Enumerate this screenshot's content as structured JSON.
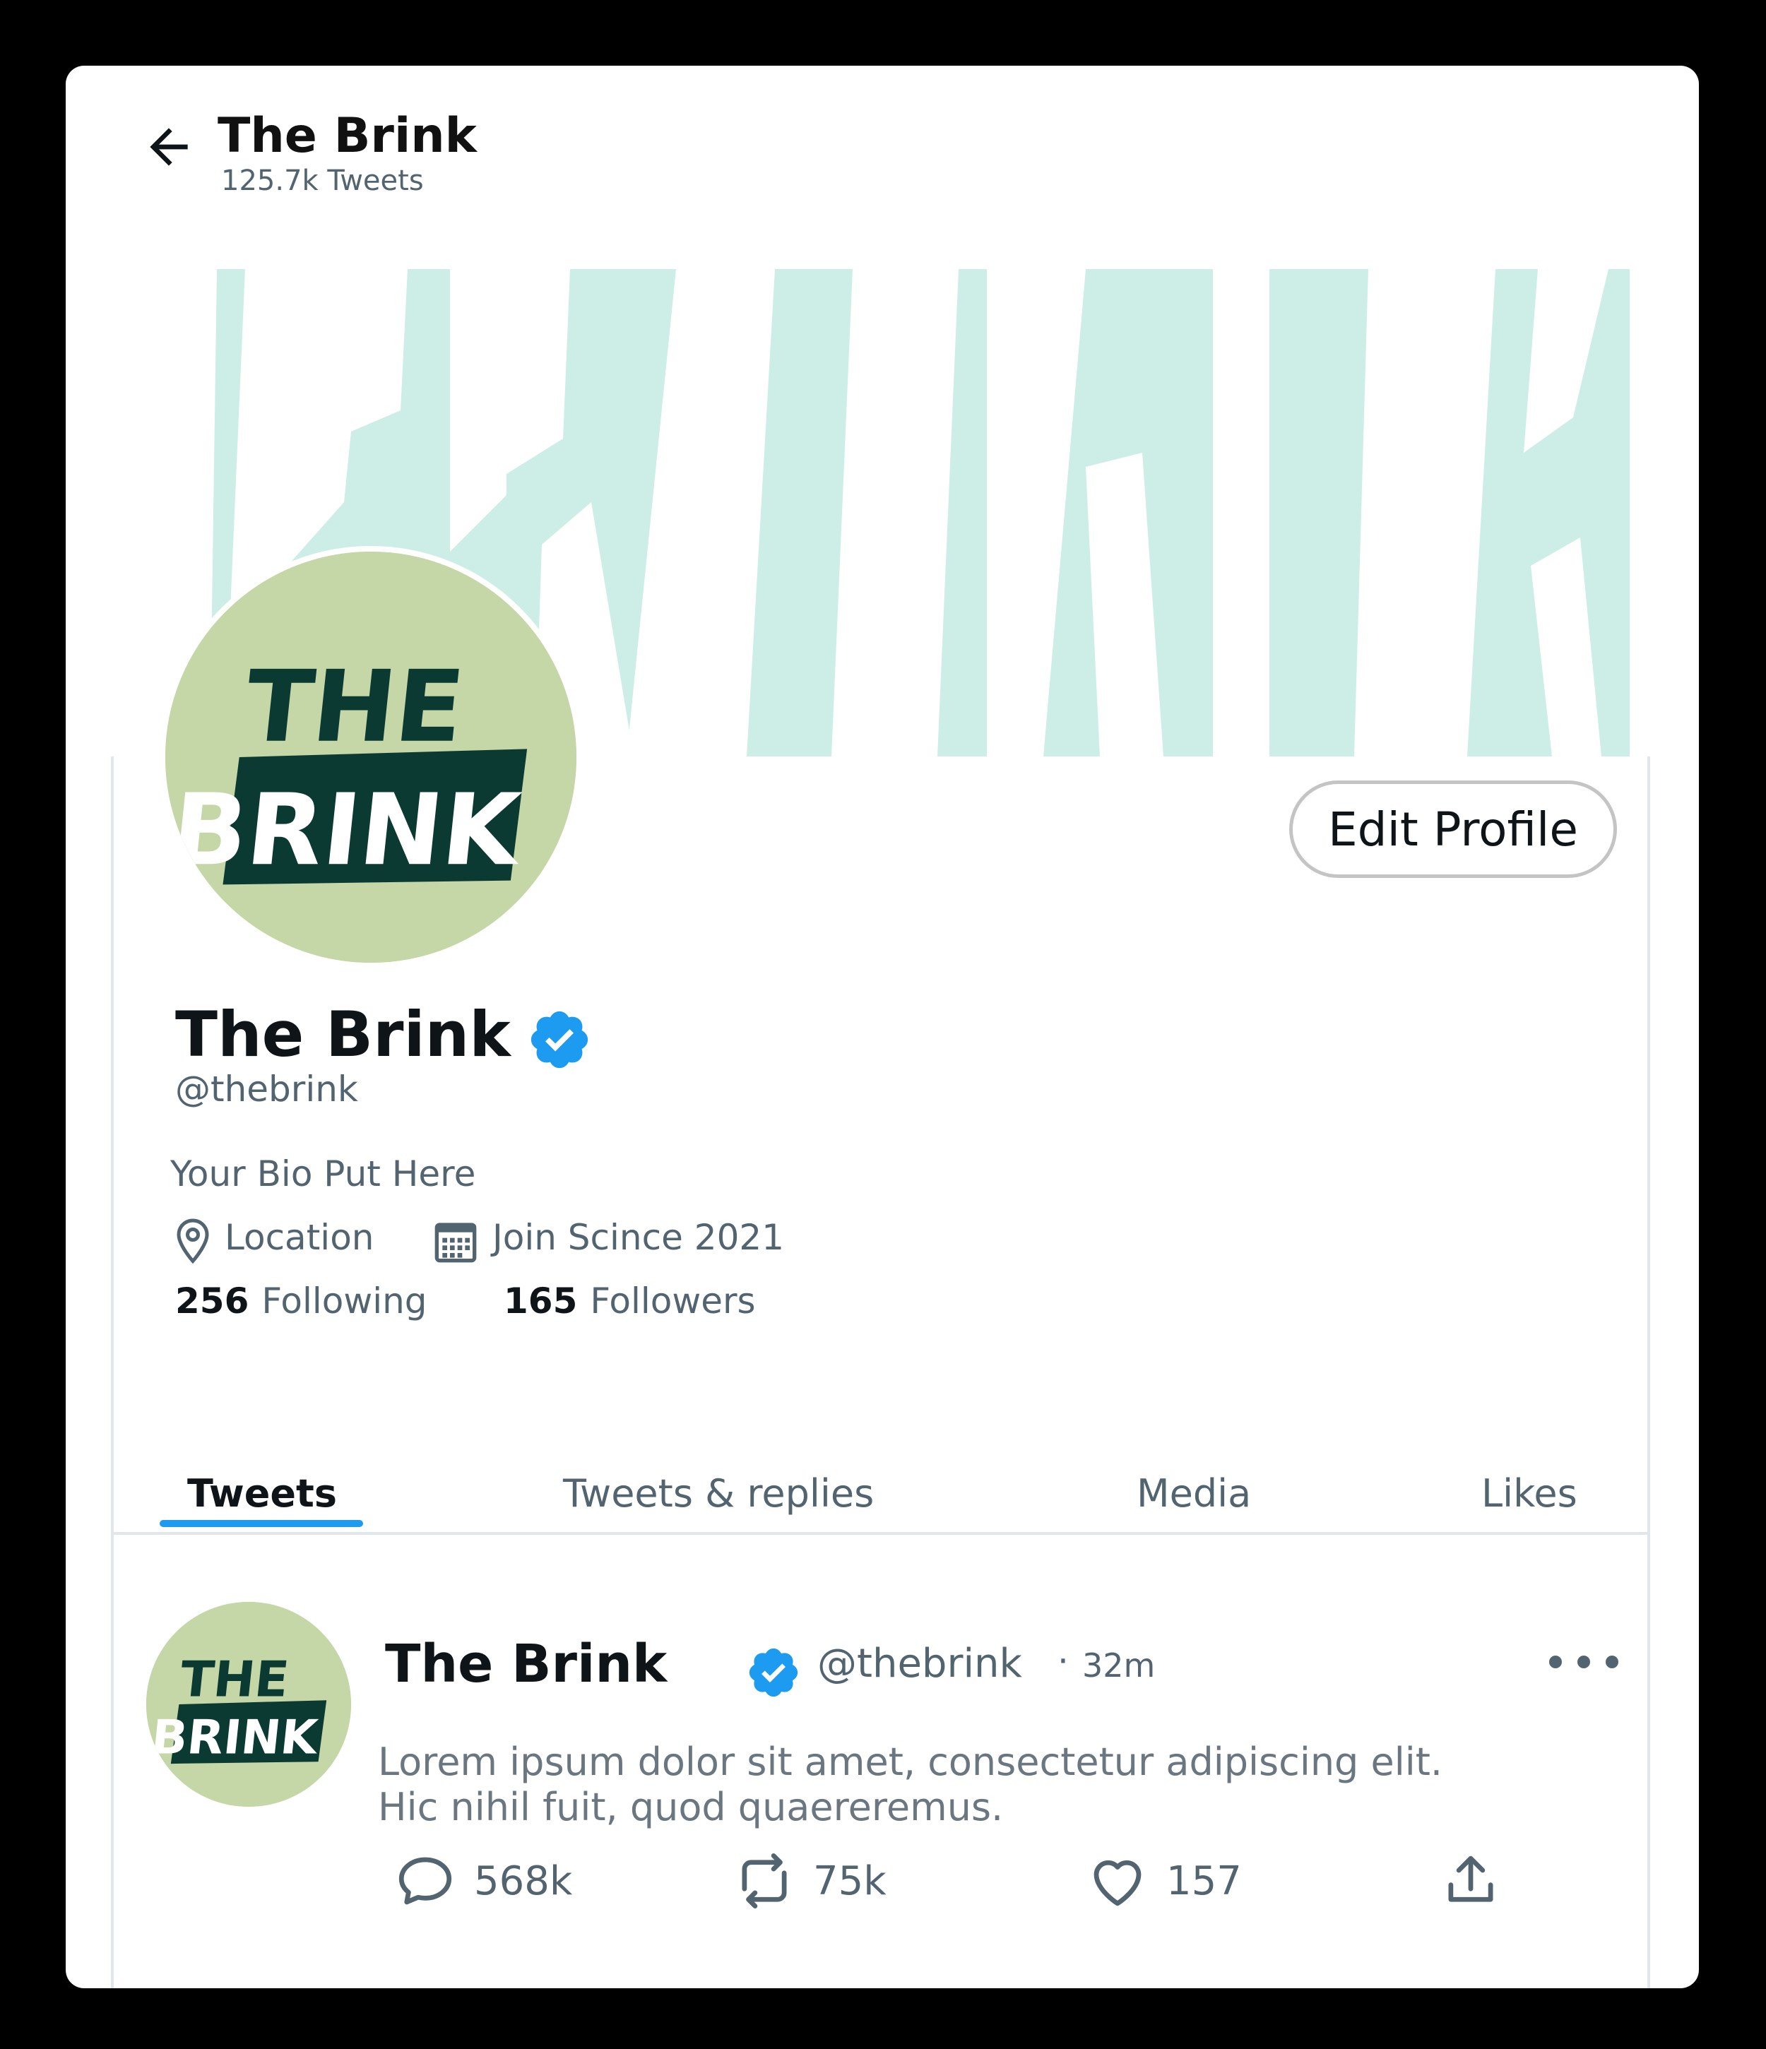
{
  "header": {
    "title": "The Brink",
    "tweet_count": "125.7k Tweets"
  },
  "banner": {
    "text": "BRINK",
    "bg_color": "#cdeee6"
  },
  "logo": {
    "line1": "THE",
    "line2": "BRINK",
    "bg_color": "#c5d6a7",
    "ink_color": "#0b3a33"
  },
  "profile": {
    "edit_label": "Edit Profile",
    "name": "The Brink",
    "handle": "@thebrink",
    "bio": "Your Bio Put Here",
    "location": "Location",
    "joined": "Join Scince 2021",
    "following_count": "256",
    "following_label": "Following",
    "followers_count": "165",
    "followers_label": "Followers",
    "verified_color": "#1d9bf0"
  },
  "tabs": [
    {
      "label": "Tweets",
      "active": true
    },
    {
      "label": "Tweets & replies",
      "active": false
    },
    {
      "label": "Media",
      "active": false
    },
    {
      "label": "Likes",
      "active": false
    }
  ],
  "tweet": {
    "name": "The Brink",
    "handle": "@thebrink",
    "separator": "·",
    "time": "32m",
    "text_line1": "Lorem ipsum dolor sit amet, consectetur adipiscing elit.",
    "text_line2": "Hic nihil fuit, quod quaereremus.",
    "replies": "568k",
    "retweets": "75k",
    "likes": "157"
  }
}
